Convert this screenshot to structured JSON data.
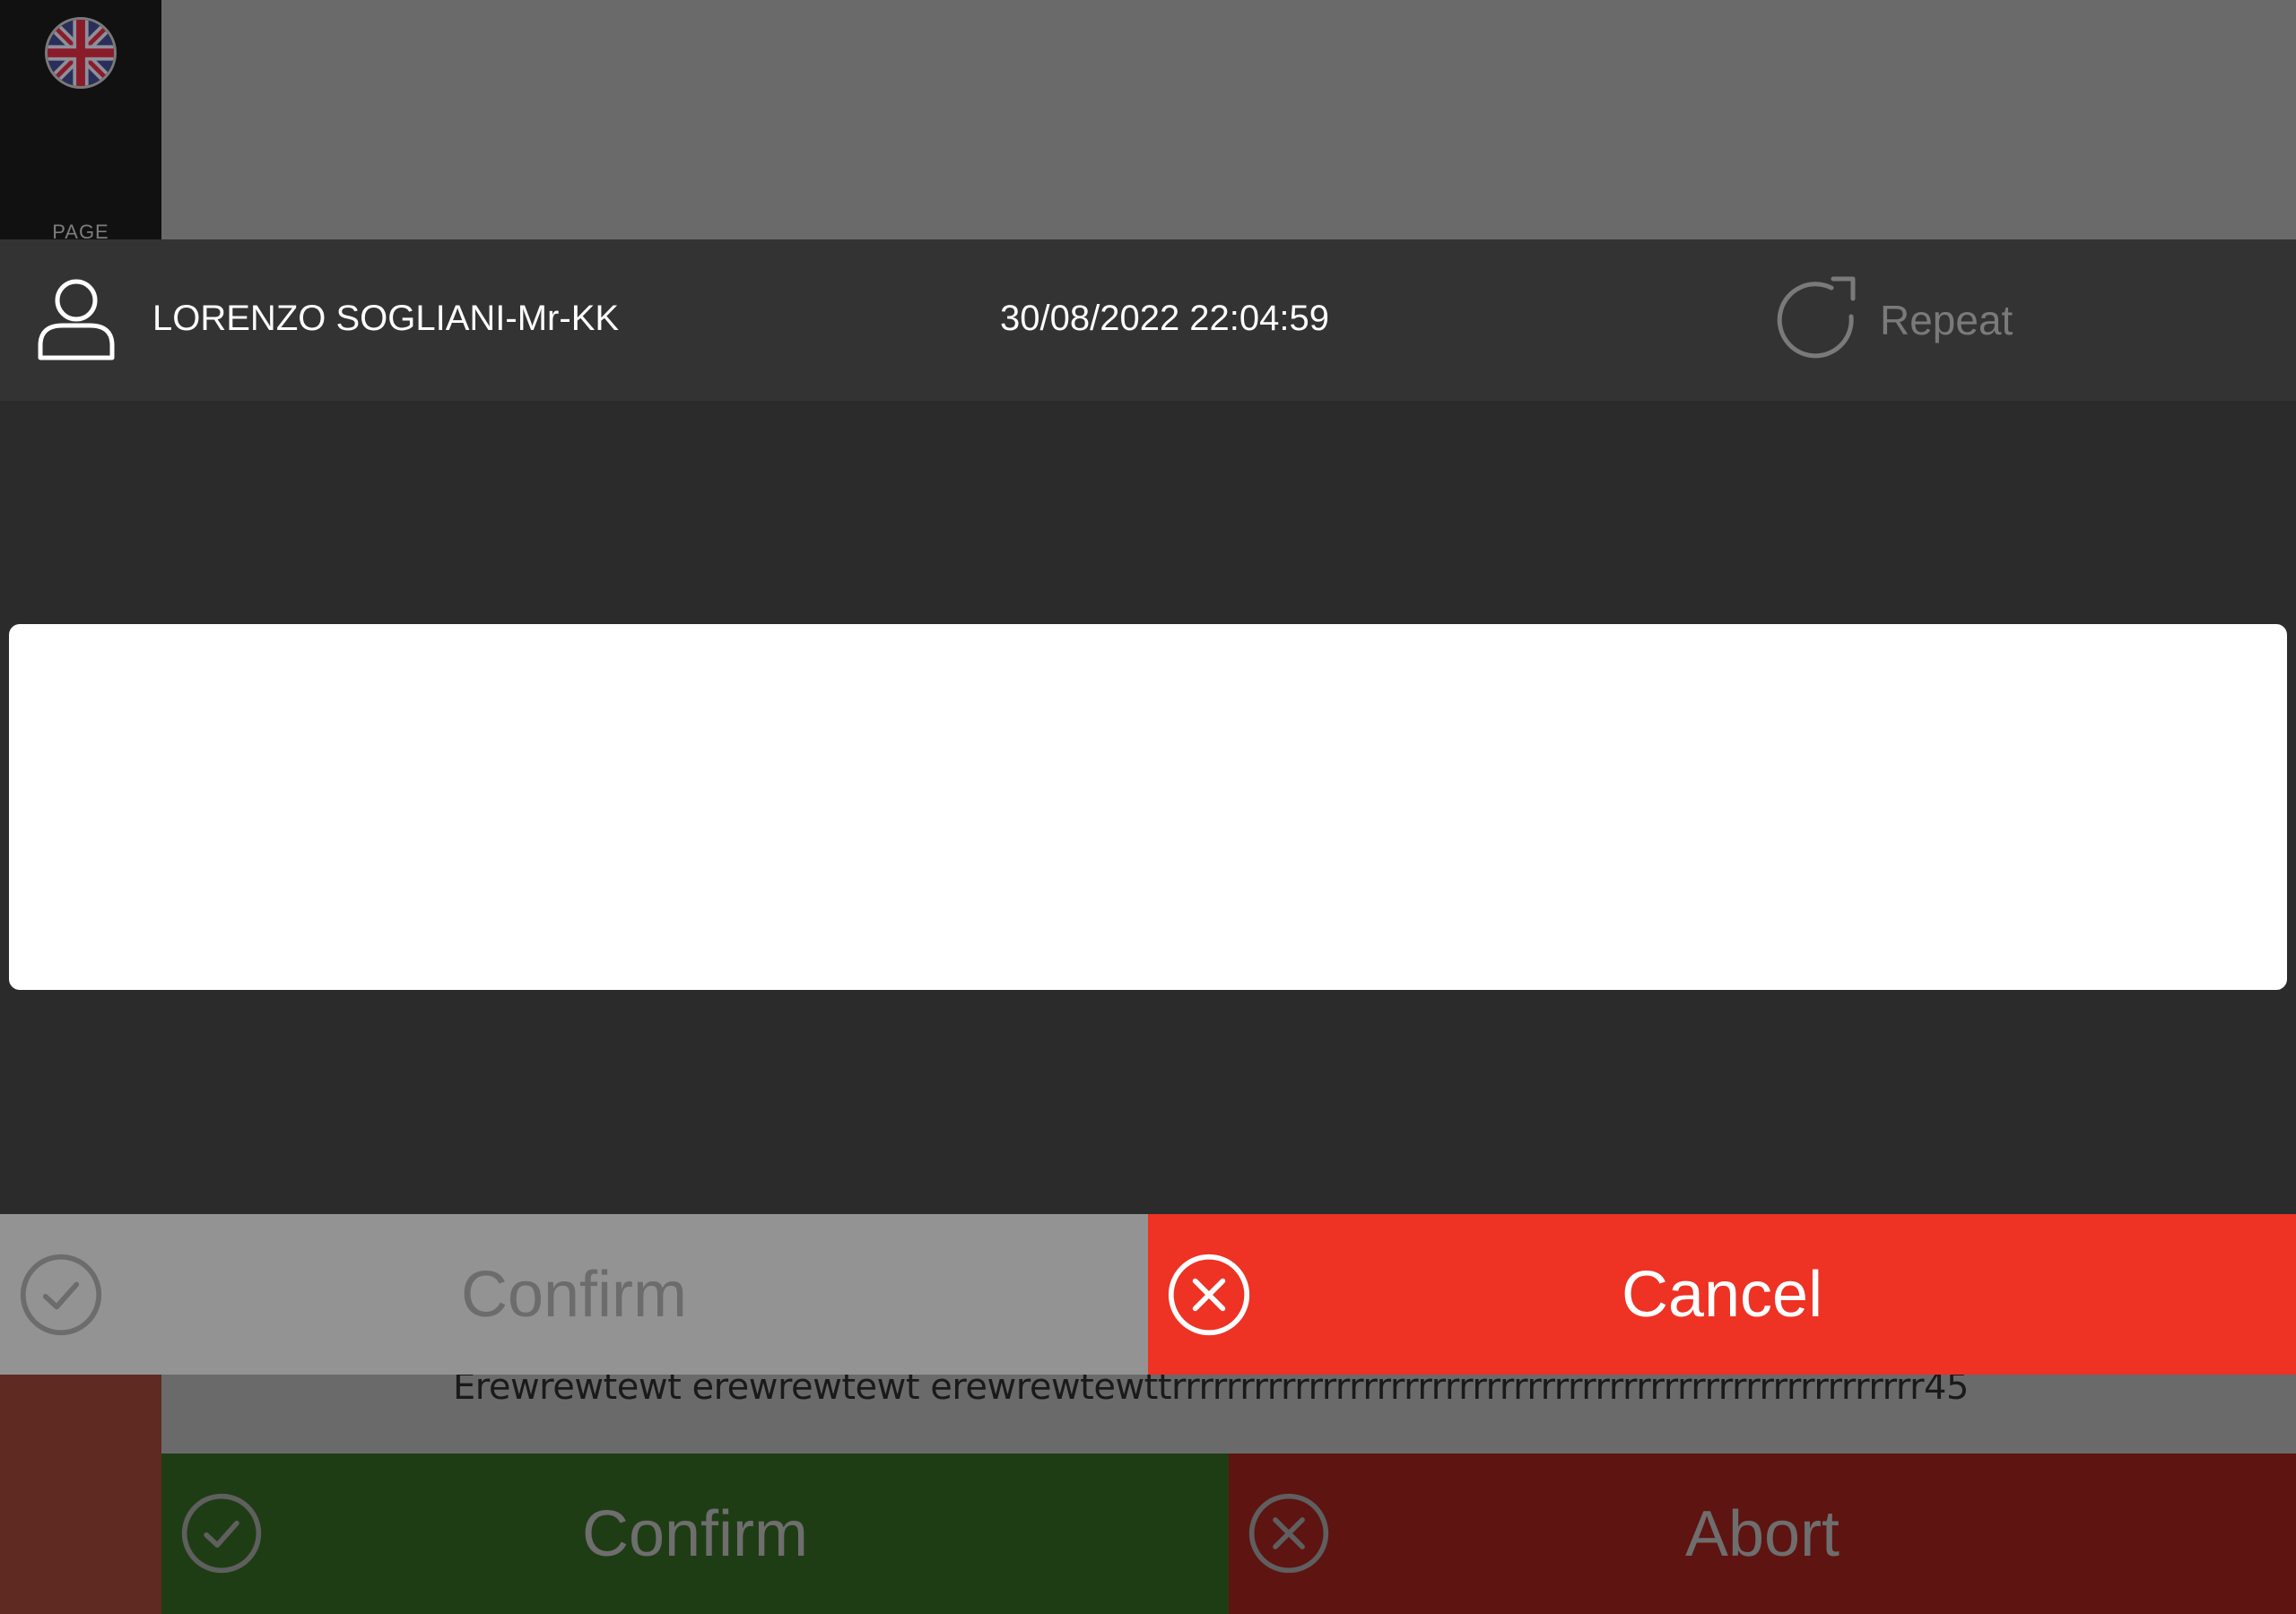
{
  "background_app": {
    "language_flag": "uk-flag-icon",
    "sidebar_label": "PAGE",
    "long_text": "Erewrewtewt erewrewtewt erewrewtewttrrrrrrrrrrrrrrrrrrrrrrrrrrrrrrrrrrrrrrrrrrrrrrrrrrrrrrr45",
    "confirm_label": "Confirm",
    "abort_label": "Abort",
    "colors": {
      "confirm": "#1f3d14",
      "abort": "#5e1411"
    }
  },
  "dialog": {
    "user_name": "LORENZO SOGLIANI-Mr-KK",
    "datetime": "30/08/2022 22:04:59",
    "repeat_label": "Repeat",
    "text_value": "",
    "confirm_label": "Confirm",
    "cancel_label": "Cancel",
    "colors": {
      "cancel": "#ee3224",
      "confirm_disabled": "#939393"
    }
  }
}
